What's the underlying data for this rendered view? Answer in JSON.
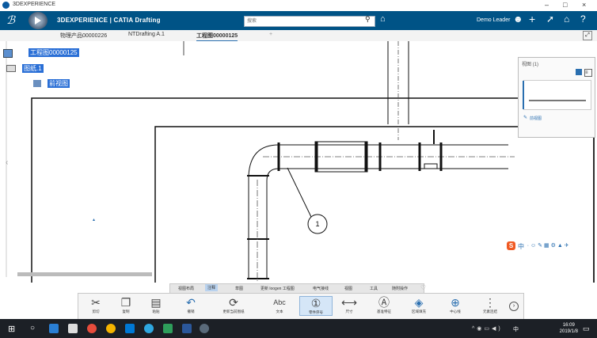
{
  "os": {
    "title": "3DEXPERIENCE",
    "minimize": "–",
    "maximize": "□",
    "close": "×"
  },
  "header": {
    "brand": "3DEXPERIENCE | CATIA Drafting",
    "search_placeholder": "搜索",
    "user": "Demo Leader"
  },
  "tabs": [
    {
      "label": "物理产品00000226"
    },
    {
      "label": "NTDrafting A.1"
    },
    {
      "label": "工程图00000125"
    },
    {
      "label": "+"
    }
  ],
  "tree": {
    "root": "工程图00000125",
    "sheet": "图纸.1",
    "view": "前视图"
  },
  "view_panel": {
    "title": "视图 (1)",
    "item": "前视图"
  },
  "balloon": {
    "label": "1"
  },
  "ribbon_tabs": [
    "视图布局",
    "注释",
    "草图",
    "更新 loogen 工程图",
    "电气接线",
    "视图",
    "工具",
    "随附操作"
  ],
  "ribbon_active_tab": "注释",
  "commands": [
    {
      "label": "剪切",
      "icon": "scissors-icon",
      "glyph": "✂"
    },
    {
      "label": "复制",
      "icon": "copy-icon",
      "glyph": "❐"
    },
    {
      "label": "粘贴",
      "icon": "paste-icon",
      "glyph": "▤"
    },
    {
      "label": "撤销",
      "icon": "undo-icon",
      "glyph": "↶"
    },
    {
      "label": "更新当前图纸",
      "icon": "update-sheet-icon",
      "glyph": "⟳"
    },
    {
      "label": "文本",
      "icon": "text-icon",
      "glyph": "Abc"
    },
    {
      "label": "零件序号",
      "icon": "balloon-icon",
      "glyph": "①"
    },
    {
      "label": "尺寸",
      "icon": "dimension-icon",
      "glyph": "⟷"
    },
    {
      "label": "基准特征",
      "icon": "datum-icon",
      "glyph": "Ⓐ"
    },
    {
      "label": "区域填充",
      "icon": "area-fill-icon",
      "glyph": "◈"
    },
    {
      "label": "中心线",
      "icon": "centerline-icon",
      "glyph": "⊕"
    },
    {
      "label": "元素连结",
      "icon": "element-link-icon",
      "glyph": "⋮"
    }
  ],
  "clock": {
    "time": "16:09",
    "date": "2019/1/8"
  },
  "ime": {
    "mode": "中"
  }
}
